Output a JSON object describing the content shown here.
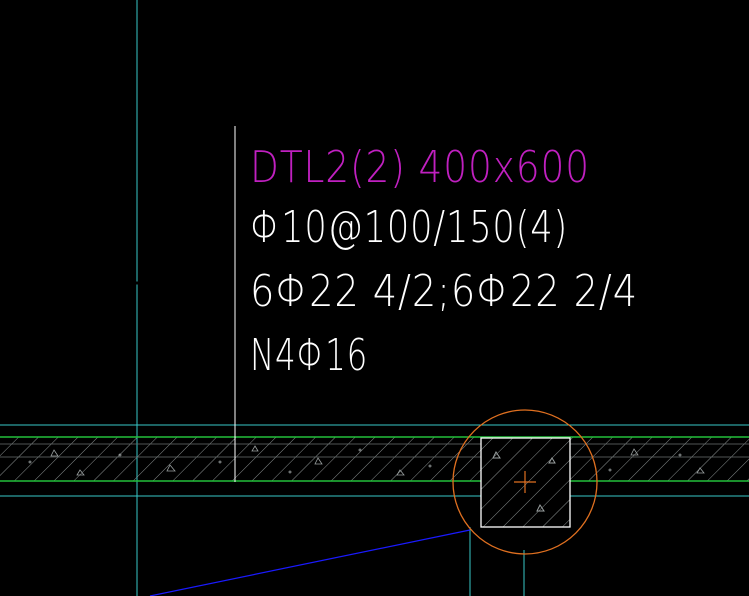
{
  "beam_annotation": {
    "line1": "DTL2(2) 400x600",
    "line2": "Φ10@100/150(4)",
    "line3": "6Φ22 4/2;6Φ22 2/4",
    "line4": "N4Φ16"
  },
  "colors": {
    "background": "#000000",
    "axis": "#37c8c8",
    "beam_edge": "#22c03a",
    "leader_line": "#ffffff",
    "beam_name_text": "#c020c0",
    "annotation_text": "#ffffff",
    "column_marker": "#e07020",
    "diagonal_line": "#1a1aff",
    "hatch": "#9aa0a0"
  }
}
